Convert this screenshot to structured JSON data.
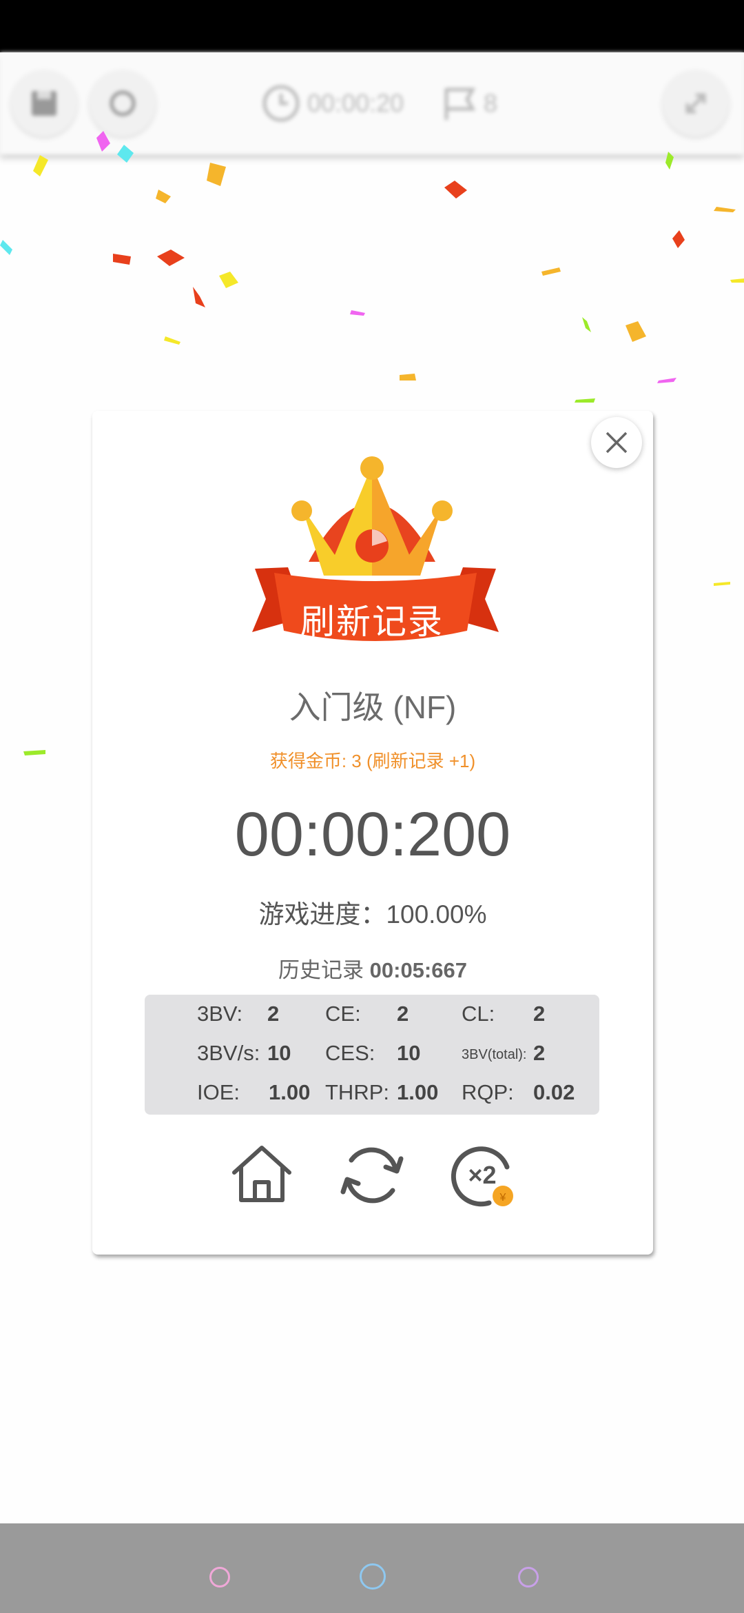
{
  "toolbar": {
    "timer": "00:00:20",
    "flags": "8"
  },
  "dialog": {
    "record_banner": "刷新记录",
    "level": "入门级 (NF)",
    "coins_text": "获得金币: 3 (刷新记录 +1)",
    "time": "00:00:200",
    "progress_label": "游戏进度：",
    "progress_value": "100.00%",
    "history_label": "历史记录",
    "history_value": "00:05:667",
    "stats": {
      "bv_label": "3BV:",
      "bv": "2",
      "ce_label": "CE:",
      "ce": "2",
      "cl_label": "CL:",
      "cl": "2",
      "bvs_label": "3BV/s:",
      "bvs": "10",
      "ces_label": "CES:",
      "ces": "10",
      "bvtotal_label": "3BV(total):",
      "bvtotal": "2",
      "ioe_label": "IOE:",
      "ioe": "1.00",
      "thrp_label": "THRP:",
      "thrp": "1.00",
      "rqp_label": "RQP:",
      "rqp": "0.02"
    },
    "double_icon_text": "×2",
    "coin_icon_text": "¥"
  },
  "colors": {
    "accent_orange": "#f0902a",
    "banner_red": "#e8401c",
    "crown_gold": "#f5b52c"
  }
}
